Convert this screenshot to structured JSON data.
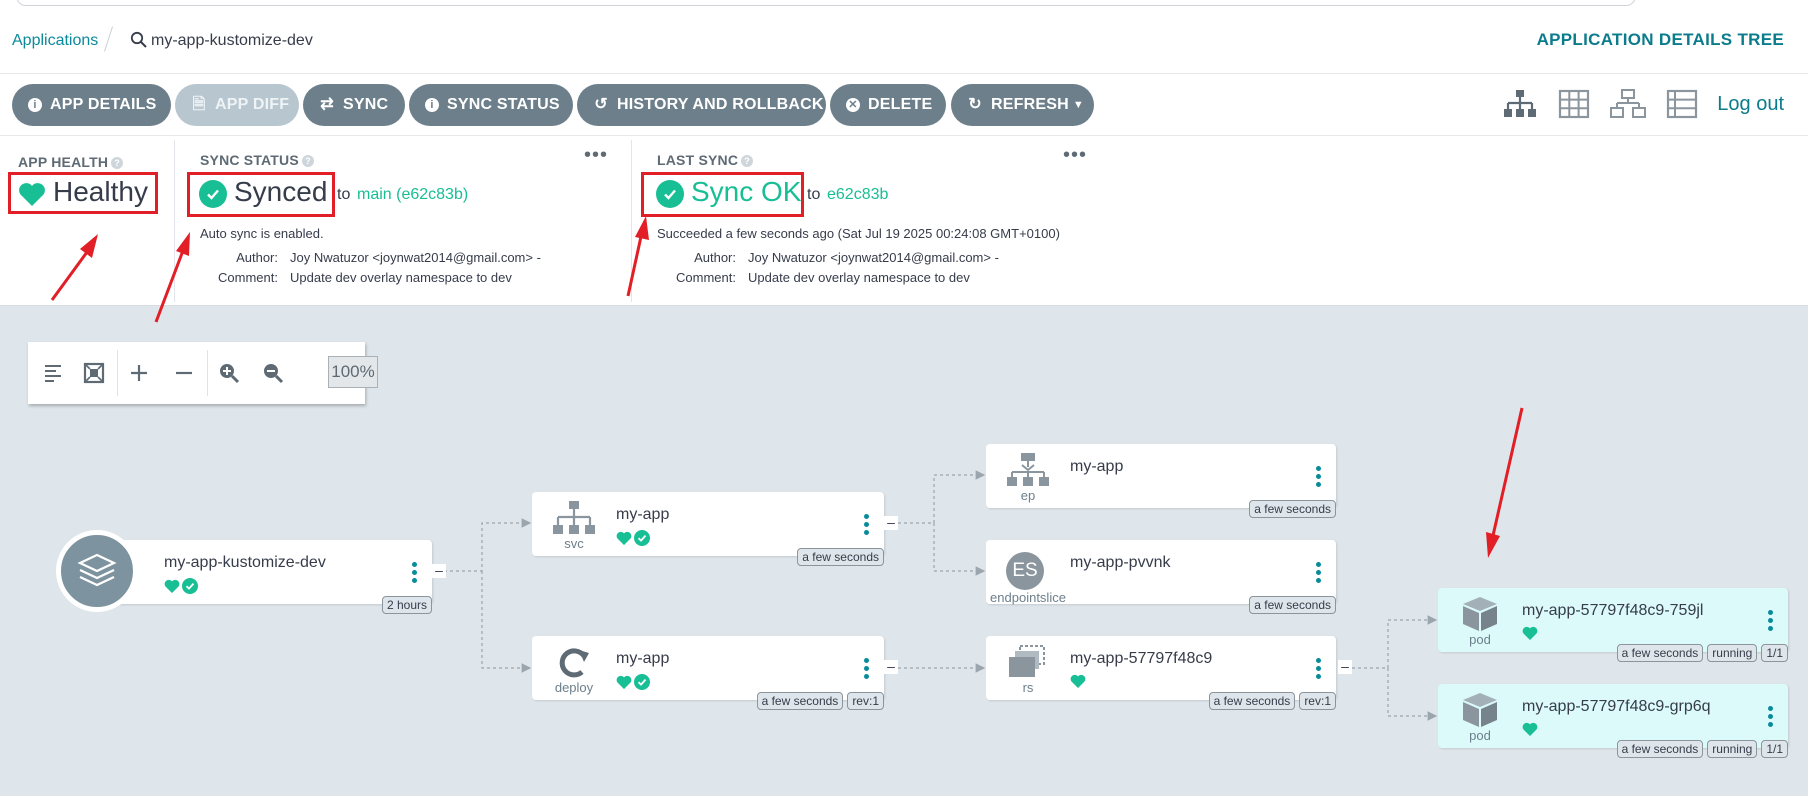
{
  "breadcrumb": {
    "applications": "Applications",
    "app_name": "my-app-kustomize-dev"
  },
  "page_title": "APPLICATION DETAILS TREE",
  "toolbar": {
    "buttons": [
      {
        "label": "APP DETAILS",
        "icon": "info-icon"
      },
      {
        "label": "APP DIFF",
        "icon": "file-diff-icon",
        "disabled": true
      },
      {
        "label": "SYNC",
        "icon": "sync-icon"
      },
      {
        "label": "SYNC STATUS",
        "icon": "info-icon"
      },
      {
        "label": "HISTORY AND ROLLBACK",
        "icon": "history-icon"
      },
      {
        "label": "DELETE",
        "icon": "close-circle-icon"
      },
      {
        "label": "REFRESH",
        "icon": "refresh-icon"
      }
    ],
    "logout": "Log out"
  },
  "app_health": {
    "label": "APP HEALTH",
    "status": "Healthy"
  },
  "sync_status": {
    "label": "SYNC STATUS",
    "status": "Synced",
    "to": "to",
    "revision": "main (e62c83b)",
    "auto_sync": "Auto sync is enabled.",
    "author_label": "Author:",
    "author": "Joy Nwatuzor <joynwat2014@gmail.com> -",
    "comment_label": "Comment:",
    "comment": "Update dev overlay namespace to dev"
  },
  "last_sync": {
    "label": "LAST SYNC",
    "status": "Sync OK",
    "to": "to",
    "revision": "e62c83b",
    "succeeded": "Succeeded a few seconds ago (Sat Jul 19 2025 00:24:08 GMT+0100)",
    "author_label": "Author:",
    "author": "Joy Nwatuzor <joynwat2014@gmail.com> -",
    "comment_label": "Comment:",
    "comment": "Update dev overlay namespace to dev"
  },
  "zoom": {
    "level": "100%"
  },
  "tree": {
    "app": {
      "name": "my-app-kustomize-dev",
      "age": "2 hours"
    },
    "svc": {
      "name": "my-app",
      "kind": "svc",
      "age": "a few seconds"
    },
    "deploy": {
      "name": "my-app",
      "kind": "deploy",
      "age": "a few seconds",
      "rev": "rev:1"
    },
    "ep": {
      "name": "my-app",
      "kind": "ep",
      "age": "a few seconds"
    },
    "endpointslice": {
      "name": "my-app-pvvnk",
      "kind": "endpointslice",
      "badge": "ES",
      "age": "a few seconds"
    },
    "rs": {
      "name": "my-app-57797f48c9",
      "kind": "rs",
      "age": "a few seconds",
      "rev": "rev:1"
    },
    "pod1": {
      "name": "my-app-57797f48c9-759jl",
      "kind": "pod",
      "age": "a few seconds",
      "state": "running",
      "ready": "1/1"
    },
    "pod2": {
      "name": "my-app-57797f48c9-grp6q",
      "kind": "pod",
      "age": "a few seconds",
      "state": "running",
      "ready": "1/1"
    }
  },
  "colors": {
    "accent": "#0b7c8c",
    "healthy": "#18be94",
    "button": "#6d7f8b",
    "annotation": "#e21f26",
    "pod_bg": "#dcfafa"
  }
}
